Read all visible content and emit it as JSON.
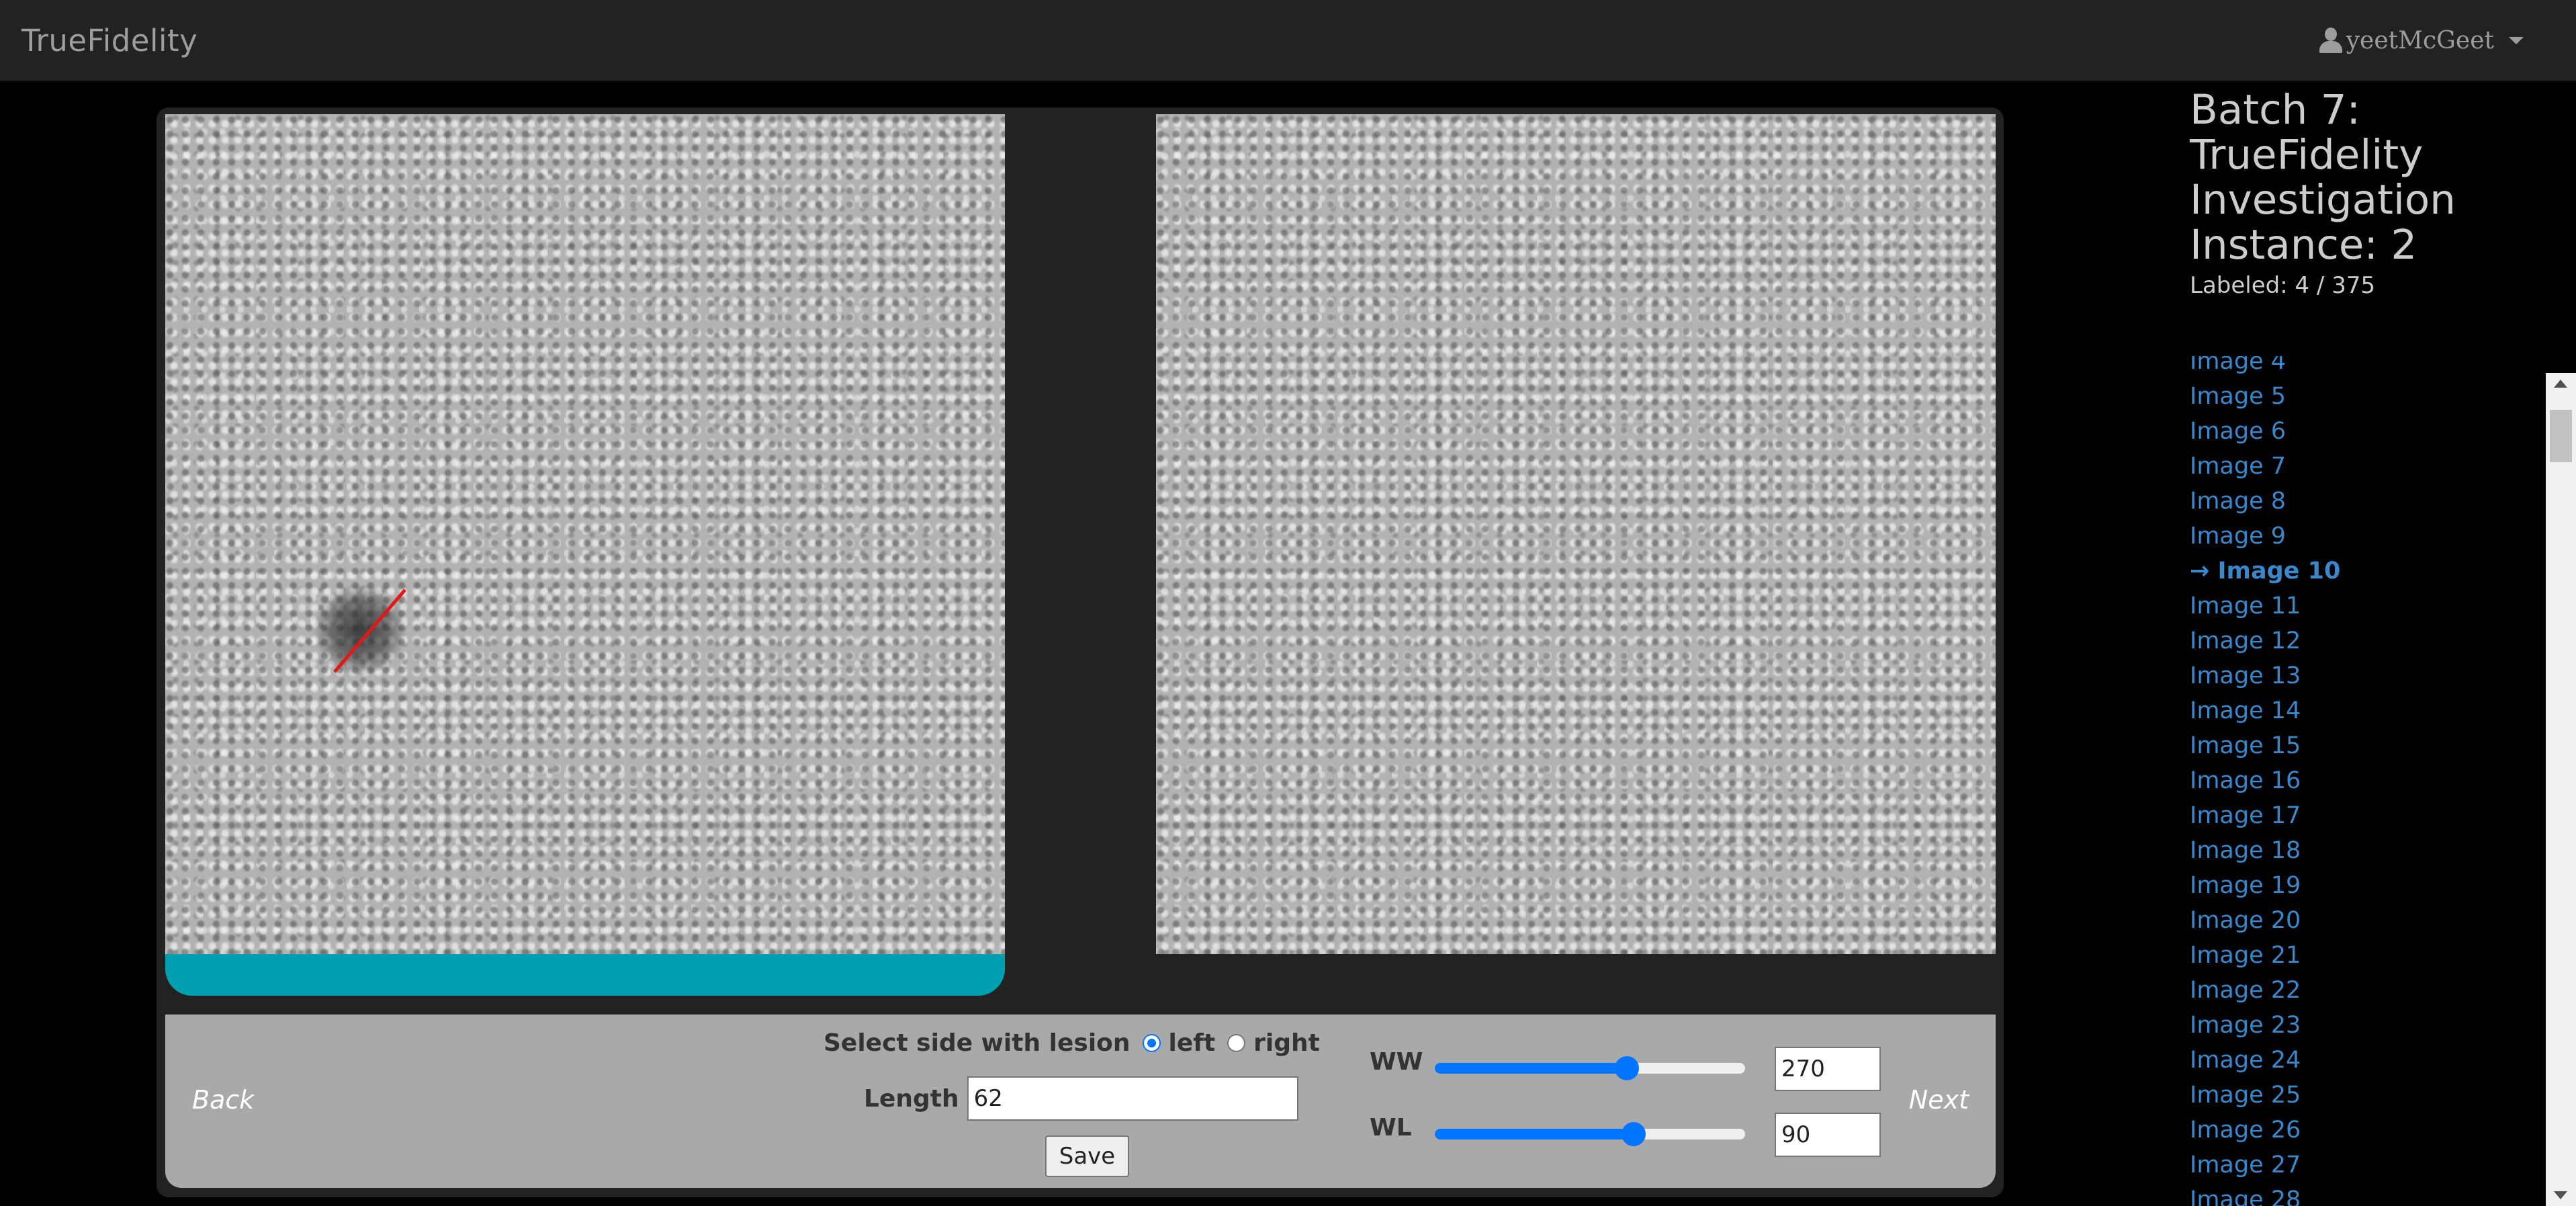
{
  "app": {
    "brand": "TrueFidelity"
  },
  "user": {
    "name": "yeetMcGeet",
    "icon": "user-icon"
  },
  "batch": {
    "title_lines": [
      "Batch 7:",
      "TrueFidelity",
      "Investigation",
      "Instance: 2"
    ],
    "labeled": "Labeled: 4 / 375"
  },
  "image_list": [
    "Image 4",
    "Image 5",
    "Image 6",
    "Image 7",
    "Image 8",
    "Image 9",
    "→ Image 10",
    "Image 11",
    "Image 12",
    "Image 13",
    "Image 14",
    "Image 15",
    "Image 16",
    "Image 17",
    "Image 18",
    "Image 19",
    "Image 20",
    "Image 21",
    "Image 22",
    "Image 23",
    "Image 24",
    "Image 25",
    "Image 26",
    "Image 27",
    "Image 28"
  ],
  "active_image": "→ Image 10",
  "controls": {
    "back": "Back",
    "next": "Next",
    "select_side_label": "Select side with lesion",
    "left_label": "left",
    "right_label": "right",
    "selected_side": "left",
    "length_label": "Length",
    "length_value": "62",
    "save_label": "Save",
    "ww_label": "WW",
    "ww_value": "270",
    "ww_fraction": 0.62,
    "wl_label": "WL",
    "wl_value": "90",
    "wl_fraction": 0.64
  },
  "colors": {
    "selected_bar": "#00a0b0",
    "measure_line": "#e01818",
    "link": "#3a87c9",
    "slider": "#0075ff"
  }
}
